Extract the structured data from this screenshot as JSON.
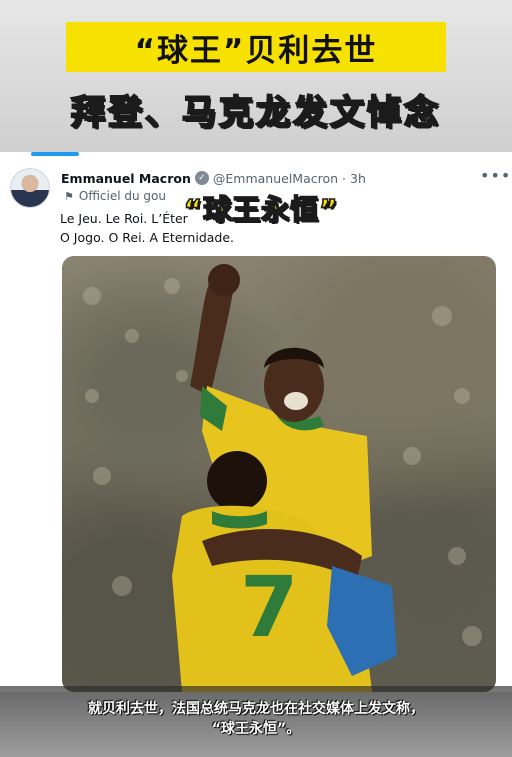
{
  "banner": {
    "headline_line1": "“球王”贝利去世",
    "headline_line2": "拜登、马克龙发文悼念",
    "colors": {
      "yellow": "#f6e100",
      "outline": "#1b1b1b"
    }
  },
  "tweet": {
    "display_name": "Emmanuel Macron",
    "handle": "@EmmanuelMacron",
    "separator": "·",
    "time_ago": "3h",
    "more_icon": "more-horizontal-icon",
    "account_label": "Officiel du gou",
    "text_line1": "Le Jeu. Le Roi. L’Éter",
    "text_line2": "O Jogo. O Rei. A Eternidade.",
    "overlay_caption": "“球王永恒”",
    "photo_alt_icon": "football-photo",
    "jersey_number": "7",
    "accent_color": "#1d9bf0"
  },
  "subtitles": {
    "line1": "就贝利去世，法国总统马克龙也在社交媒体上发文称，",
    "line2": "“球王永恒”。"
  }
}
